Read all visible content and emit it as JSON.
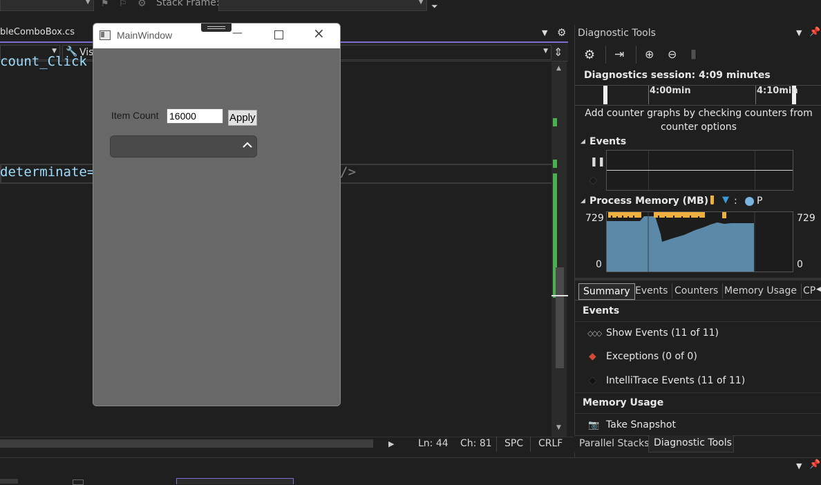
{
  "toolbar": {
    "stack_frame_label": "Stack Frame:"
  },
  "editor": {
    "tab_name": "bleComboBox.cs",
    "nav_member": "Vis",
    "code_line_1": "count_Click",
    "code_line_2": "determinate=",
    "code_line_2_tail": "/>"
  },
  "status": {
    "ln": "Ln: 44",
    "ch": "Ch: 81",
    "spc": "SPC",
    "crlf": "CRLF"
  },
  "main_window": {
    "title": "MainWindow",
    "item_count_label": "Item Count",
    "item_count_value": "16000",
    "apply_label": "Apply"
  },
  "diagnostics": {
    "title": "Diagnostic Tools",
    "session": "Diagnostics session: 4:09 minutes",
    "timeline_tick_1": "4:00min",
    "timeline_tick_2": "4:10min",
    "hint": "Add counter graphs by checking counters from counter options",
    "events_header": "Events",
    "memory_header": "Process Memory (MB)",
    "memory_legend_tail_1": ":",
    "memory_legend_tail_2": "P",
    "mem_max_left": "729",
    "mem_min_left": "0",
    "mem_max_right": "729",
    "mem_min_right": "0",
    "tabs": [
      "Summary",
      "Events",
      "Counters",
      "Memory Usage",
      "CP"
    ],
    "summary_events_header": "Events",
    "show_events": "Show Events (11 of 11)",
    "exceptions": "Exceptions (0 of 0)",
    "intellitrace": "IntelliTrace Events (11 of 11)",
    "memory_usage_header": "Memory Usage",
    "take_snapshot": "Take Snapshot"
  },
  "bottom_tabs": {
    "parallel_stacks": "Parallel Stacks",
    "diagnostic_tools": "Diagnostic Tools"
  },
  "colors": {
    "accent": "#7f6ad6",
    "memory_fill": "#5a8aa8",
    "gc_marker": "#f0b040",
    "snapshot_marker": "#3a9ad9",
    "exception": "#d04a35",
    "green_change": "#4caf50"
  }
}
